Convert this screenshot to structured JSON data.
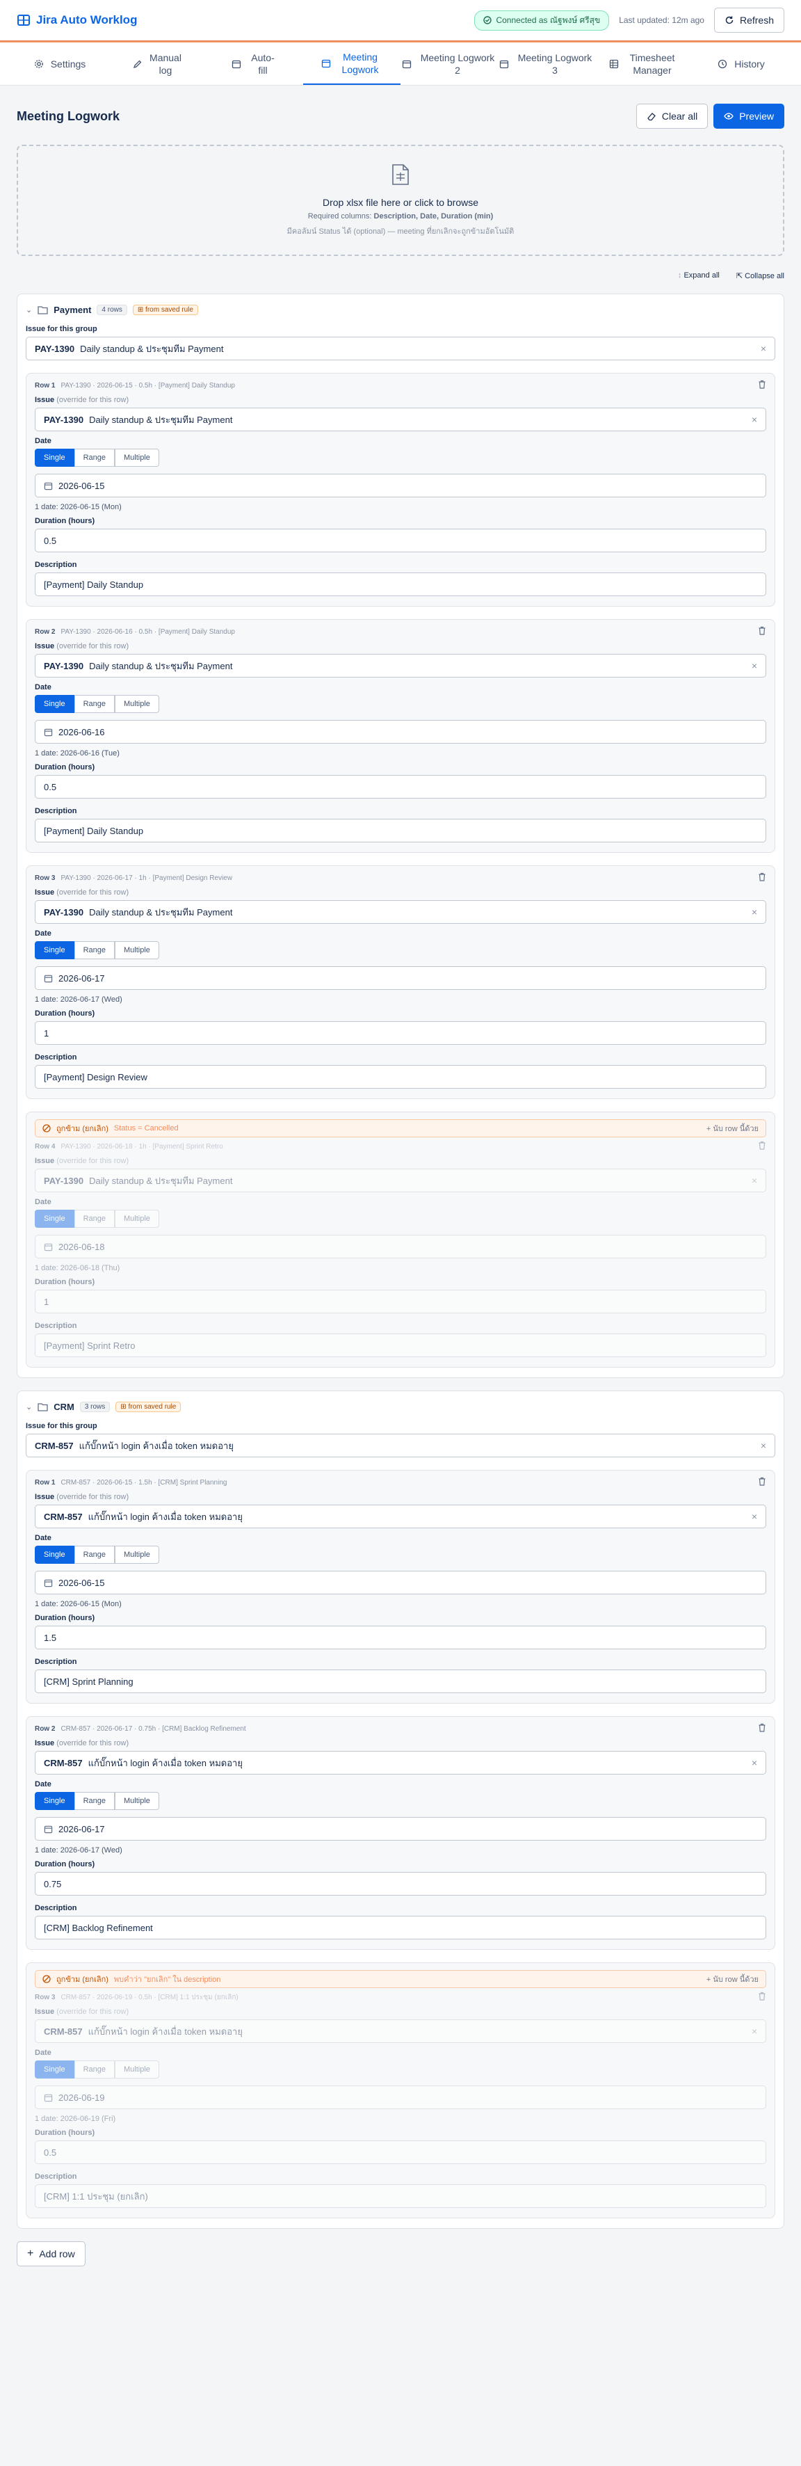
{
  "header": {
    "app_name": "Jira Auto Worklog",
    "connected": "Connected as ณัฐพงษ์ ศรีสุข",
    "updated": "Last updated: 12m ago",
    "refresh": "Refresh"
  },
  "tabs": [
    {
      "label": "Settings",
      "icon": "gear-icon"
    },
    {
      "label": "Manual log",
      "icon": "edit-icon"
    },
    {
      "label": "Auto-fill",
      "icon": "calendar-icon"
    },
    {
      "label": "Meeting Logwork",
      "icon": "calendar-icon"
    },
    {
      "label": "Meeting Logwork 2",
      "icon": "calendar-icon"
    },
    {
      "label": "Meeting Logwork 3",
      "icon": "calendar-icon"
    },
    {
      "label": "Timesheet Manager",
      "icon": "grid-icon"
    },
    {
      "label": "History",
      "icon": "history-icon"
    }
  ],
  "page": {
    "title": "Meeting Logwork",
    "clear_all": "Clear all",
    "preview": "Preview"
  },
  "drop": {
    "title": "Drop xlsx file here or click to browse",
    "required_prefix": "Required columns: ",
    "required_cols": "Description, Date, Duration (min)",
    "optional": "มีคอลัมน์ Status ได้ (optional) — meeting ที่ยกเลิกจะถูกข้ามอัตโนมัติ"
  },
  "tools": {
    "expand_all": "Expand all",
    "collapse_all": "Collapse all"
  },
  "labels": {
    "issue_group": "Issue for this group",
    "issue": "Issue",
    "override": "(override for this row)",
    "date": "Date",
    "duration": "Duration (hours)",
    "description": "Description",
    "single": "Single",
    "range": "Range",
    "multiple": "Multiple",
    "add_row": "Add row"
  },
  "groups": [
    {
      "name": "Payment",
      "rows_badge": "4 rows",
      "rule": "from saved rule",
      "issue_key": "PAY-1390",
      "issue_summary": "Daily standup & ประชุมทีม Payment",
      "rows": [
        {
          "label": "Row 1",
          "summary": "PAY-1390 · 2026-06-15 · 0.5h · [Payment] Daily Standup",
          "date": "2026-06-15",
          "date_note": "1 date: 2026-06-15 (Mon)",
          "duration": "0.5",
          "description": "[Payment] Daily Standup",
          "cancelled": false
        },
        {
          "label": "Row 2",
          "summary": "PAY-1390 · 2026-06-16 · 0.5h · [Payment] Daily Standup",
          "date": "2026-06-16",
          "date_note": "1 date: 2026-06-16 (Tue)",
          "duration": "0.5",
          "description": "[Payment] Daily Standup",
          "cancelled": false
        },
        {
          "label": "Row 3",
          "summary": "PAY-1390 · 2026-06-17 · 1h · [Payment] Design Review",
          "date": "2026-06-17",
          "date_note": "1 date: 2026-06-17 (Wed)",
          "duration": "1",
          "description": "[Payment] Design Review",
          "cancelled": false
        },
        {
          "label": "Row 4",
          "summary": "PAY-1390 · 2026-06-18 · 1h · [Payment] Sprint Retro",
          "date": "2026-06-18",
          "date_note": "1 date: 2026-06-18 (Thu)",
          "duration": "1",
          "description": "[Payment] Sprint Retro",
          "cancelled": true,
          "cancel_label": "ถูกข้าม (ยกเลิก)",
          "cancel_reason": "Status = Cancelled",
          "cancel_action": "นับ row นี้ด้วย"
        }
      ]
    },
    {
      "name": "CRM",
      "rows_badge": "3 rows",
      "rule": "from saved rule",
      "issue_key": "CRM-857",
      "issue_summary": "แก้บั๊กหน้า login ค้างเมื่อ token หมดอายุ",
      "rows": [
        {
          "label": "Row 1",
          "summary": "CRM-857 · 2026-06-15 · 1.5h · [CRM] Sprint Planning",
          "date": "2026-06-15",
          "date_note": "1 date: 2026-06-15 (Mon)",
          "duration": "1.5",
          "description": "[CRM] Sprint Planning",
          "cancelled": false
        },
        {
          "label": "Row 2",
          "summary": "CRM-857 · 2026-06-17 · 0.75h · [CRM] Backlog Refinement",
          "date": "2026-06-17",
          "date_note": "1 date: 2026-06-17 (Wed)",
          "duration": "0.75",
          "description": "[CRM] Backlog Refinement",
          "cancelled": false
        },
        {
          "label": "Row 3",
          "summary": "CRM-857 · 2026-06-19 · 0.5h · [CRM] 1:1 ประชุม (ยกเลิก)",
          "date": "2026-06-19",
          "date_note": "1 date: 2026-06-19 (Fri)",
          "duration": "0.5",
          "description": "[CRM] 1:1 ประชุม (ยกเลิก)",
          "cancelled": true,
          "cancel_label": "ถูกข้าม (ยกเลิก)",
          "cancel_reason": "พบคำว่า \"ยกเลิก\" ใน description",
          "cancel_action": "นับ row นี้ด้วย"
        }
      ]
    }
  ],
  "colors": {
    "primary": "#0c66e4",
    "accent": "#f18d5e",
    "success": "#216e4e"
  }
}
